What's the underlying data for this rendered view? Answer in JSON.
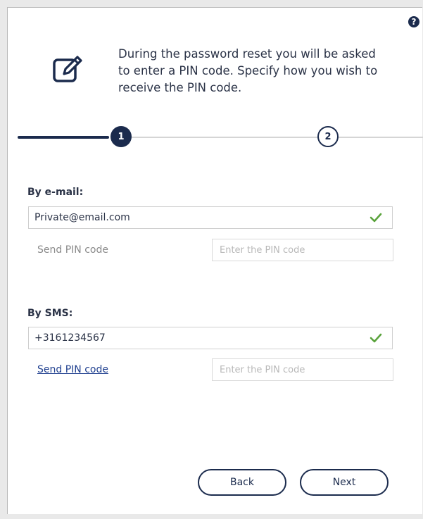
{
  "header": {
    "help_icon_glyph": "?",
    "instruction": "During the password reset you will be asked to enter a PIN code. Specify how you wish to receive the PIN code."
  },
  "stepper": {
    "steps": [
      {
        "number": "1",
        "active": true
      },
      {
        "number": "2",
        "active": false
      }
    ]
  },
  "email_section": {
    "label": "By e-mail:",
    "value": "Private@email.com",
    "verified": true,
    "send_pin_label": "Send PIN code",
    "pin_placeholder": "Enter the PIN code"
  },
  "sms_section": {
    "label": "By SMS:",
    "value": "+3161234567",
    "verified": true,
    "send_pin_label": "Send PIN code",
    "pin_placeholder": "Enter the PIN code"
  },
  "buttons": {
    "back_label": "Back",
    "next_label": "Next"
  },
  "colors": {
    "primary": "#1b2b4d",
    "check": "#5aa33c",
    "link": "#1f3f8f"
  },
  "icons": {
    "help": "help-icon",
    "edit": "edit-icon",
    "check": "check-icon"
  }
}
